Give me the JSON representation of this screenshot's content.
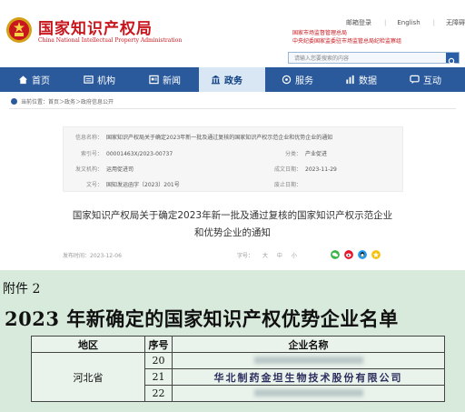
{
  "header": {
    "logo_cn": "国家知识产权局",
    "logo_en": "China National Intellectual Property Administration",
    "top_links": [
      "邮箱登录",
      "English",
      "无障碍"
    ],
    "gov_links": [
      "国家市场监督管理总局",
      "中央纪委国家监委驻市场监管总局纪检监察组"
    ],
    "search_placeholder": "请输入您要搜索的内容"
  },
  "nav": {
    "items": [
      {
        "label": "首页",
        "icon": "home-icon"
      },
      {
        "label": "机构",
        "icon": "org-icon"
      },
      {
        "label": "新闻",
        "icon": "news-icon"
      },
      {
        "label": "政务",
        "icon": "gov-icon"
      },
      {
        "label": "服务",
        "icon": "service-icon"
      },
      {
        "label": "数据",
        "icon": "data-icon"
      },
      {
        "label": "互动",
        "icon": "interact-icon"
      }
    ],
    "active": "政务"
  },
  "breadcrumb": "当前位置：首页＞政务＞政府信息公开",
  "info": {
    "title_label": "信息名称：",
    "title_value": "国家知识产权局关于确定2023年新一批及通过复核的国家知识产权示范企业和优势企业的通知",
    "index_label": "索引号：",
    "index_value": "00001463X/2023-00737",
    "category_label": "分类：",
    "category_value": "产业促进",
    "issuer_label": "发文机构：",
    "issuer_value": "运用促进司",
    "date_label": "成文日期：",
    "date_value": "2023-11-29",
    "docno_label": "文号：",
    "docno_value": "国知发运函字〔2023〕201号",
    "expiry_label": "废止日期："
  },
  "doc_title_line1": "国家知识产权局关于确定2023年新一批及通过复核的国家知识产权示范企业",
  "doc_title_line2": "和优势企业的通知",
  "meta": {
    "date_label": "发布时间：",
    "date_value": "2023-12-06",
    "size_label": "字号：",
    "sizes": [
      "大",
      "中",
      "小"
    ]
  },
  "attachment": {
    "label": "附件 2",
    "heading": "2023 年新确定的国家知识产权优势企业名单",
    "table": {
      "headers": [
        "地区",
        "序号",
        "企业名称"
      ],
      "region": "河北省",
      "rows": [
        {
          "no": "20",
          "name": ""
        },
        {
          "no": "21",
          "name": "华北制药金坦生物技术股份有限公司"
        },
        {
          "no": "22",
          "name": ""
        }
      ]
    }
  },
  "colors": {
    "brand_red": "#c8161d",
    "nav_blue": "#2a5a9c",
    "attachment_bg": "#d8eadc"
  }
}
